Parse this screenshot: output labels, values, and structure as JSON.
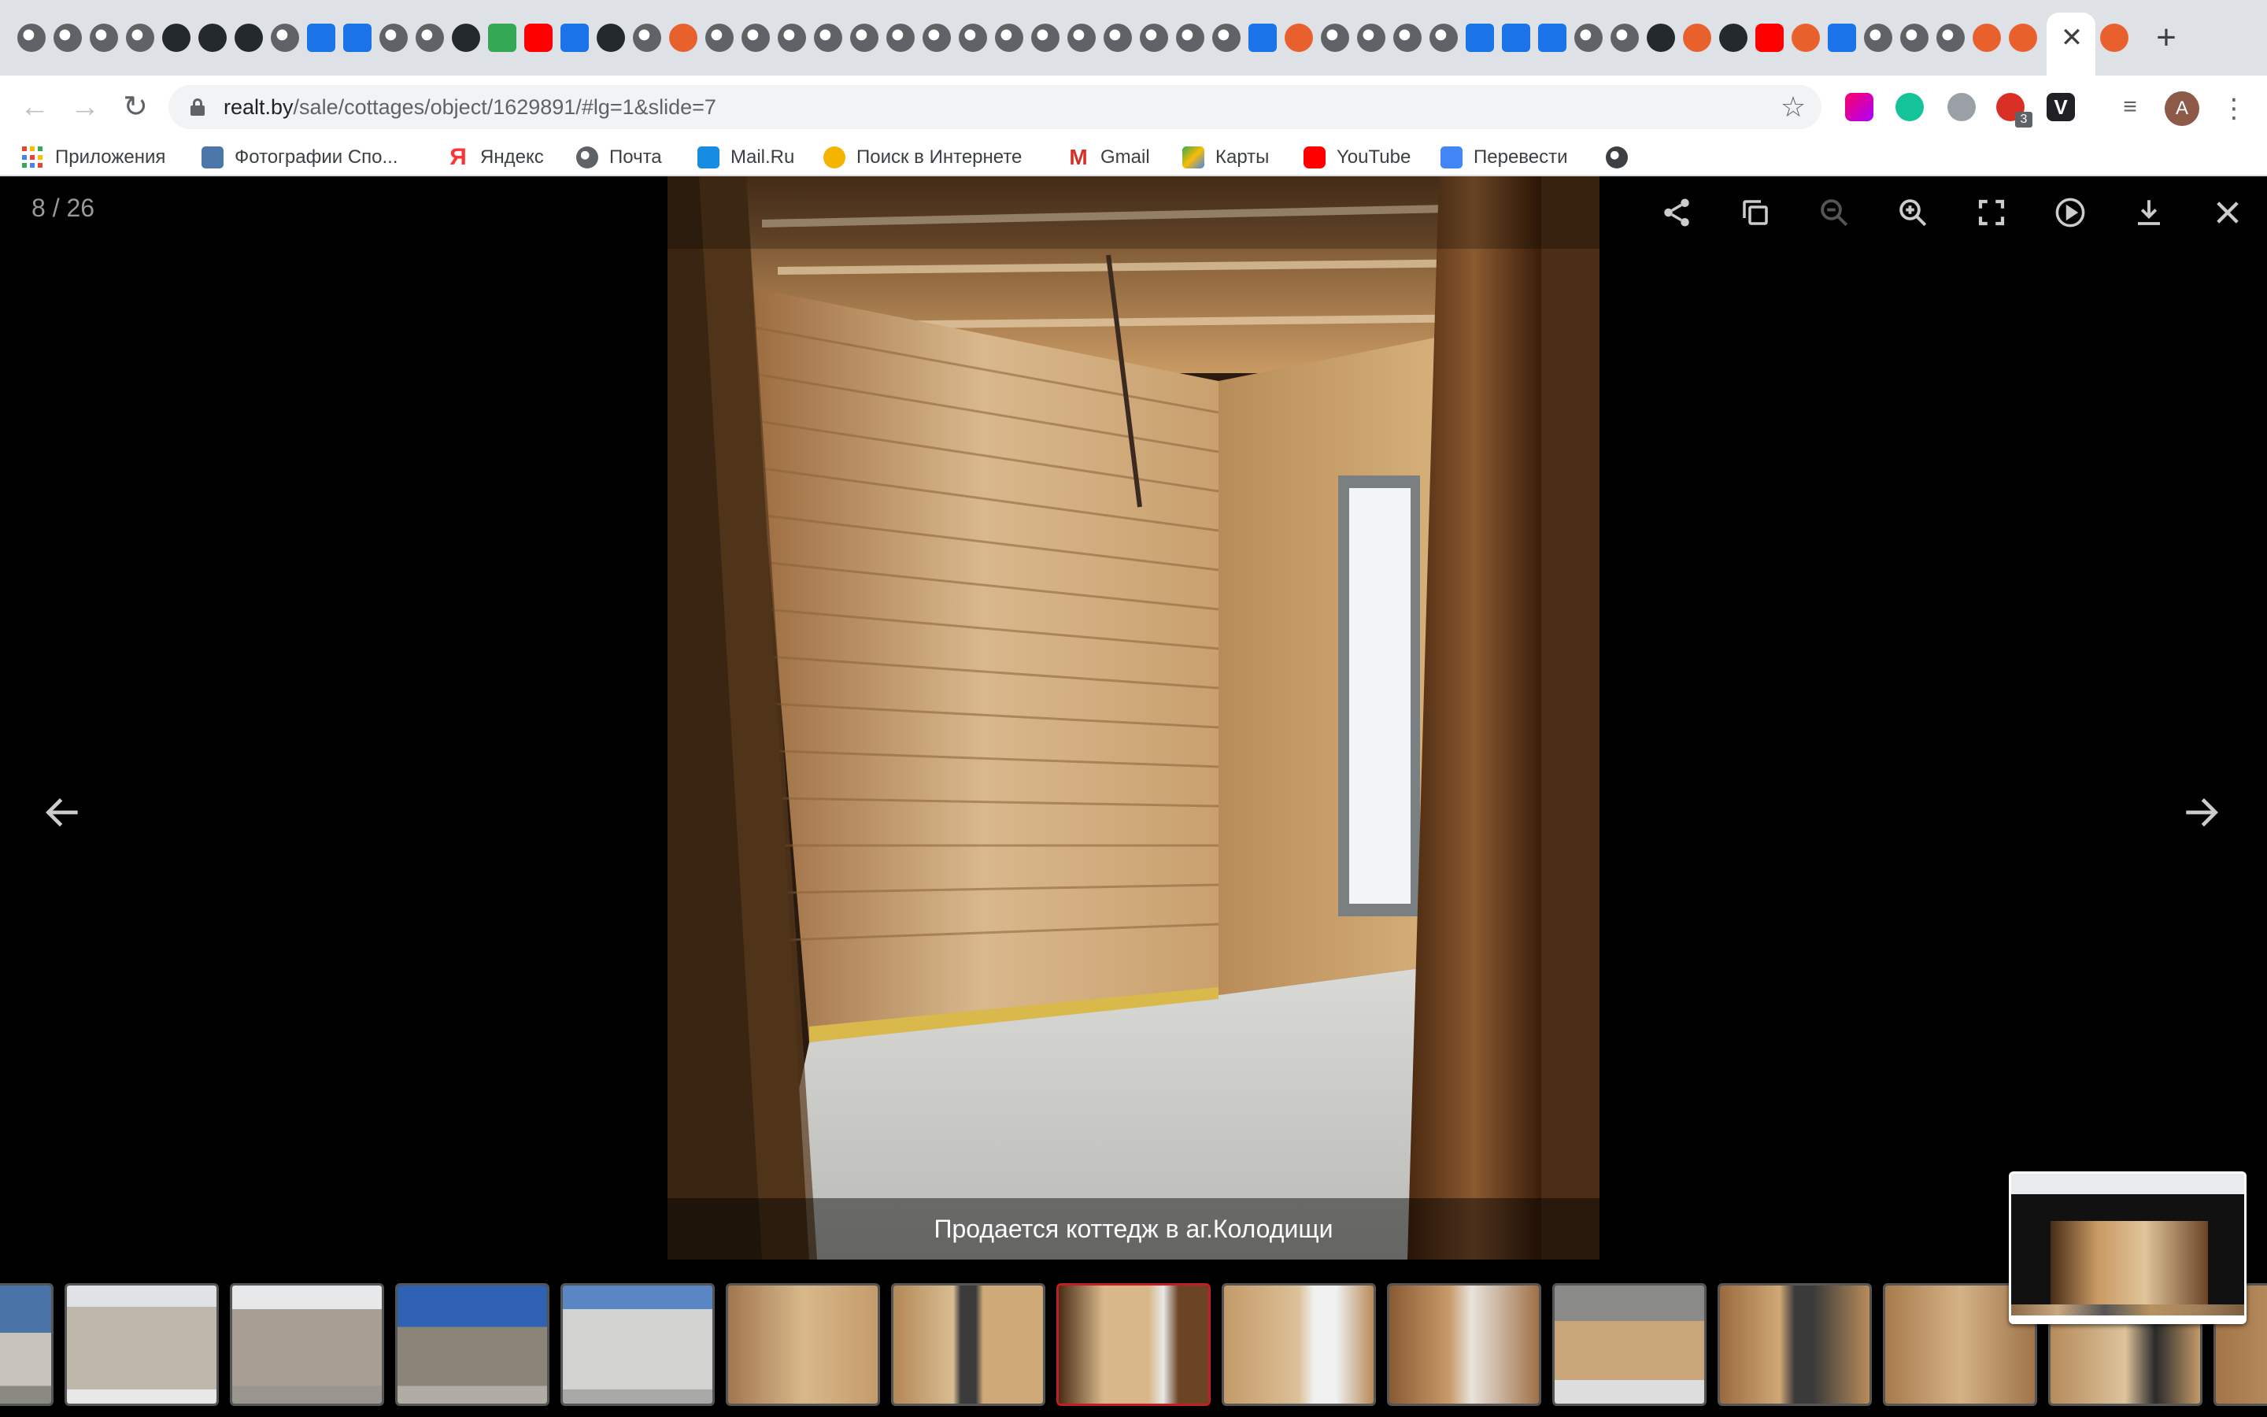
{
  "browser": {
    "url_domain": "realt.by",
    "url_path": "/sale/cottages/object/1629891/#lg=1&slide=7",
    "avatar_letter": "A",
    "extension_badge": "3",
    "extension_v_label": "V"
  },
  "bookmarks": [
    {
      "label": "Приложения",
      "icon": "apps-grid-icon"
    },
    {
      "label": "Фотографии Спо...",
      "icon": "vk-icon"
    },
    {
      "label": "Яндекс",
      "icon": "yandex-icon"
    },
    {
      "label": "Почта",
      "icon": "globe-icon"
    },
    {
      "label": "Mail.Ru",
      "icon": "mailru-icon"
    },
    {
      "label": "Поиск в Интернете",
      "icon": "search-icon"
    },
    {
      "label": "Gmail",
      "icon": "gmail-icon"
    },
    {
      "label": "Карты",
      "icon": "maps-icon"
    },
    {
      "label": "YouTube",
      "icon": "youtube-icon"
    },
    {
      "label": "Перевести",
      "icon": "translate-icon"
    }
  ],
  "gallery": {
    "counter": "8 / 26",
    "caption": "Продается коттедж в аг.Колодищи",
    "toolbar": [
      "share-icon",
      "copy-icon",
      "zoom-out-icon",
      "zoom-in-icon",
      "fullscreen-icon",
      "play-icon",
      "download-icon",
      "close-icon"
    ],
    "current_index": 7,
    "total": 26
  },
  "colors": {
    "active_thumb_border": "#c0201f",
    "chrome_tabstrip": "#dee1e6"
  }
}
